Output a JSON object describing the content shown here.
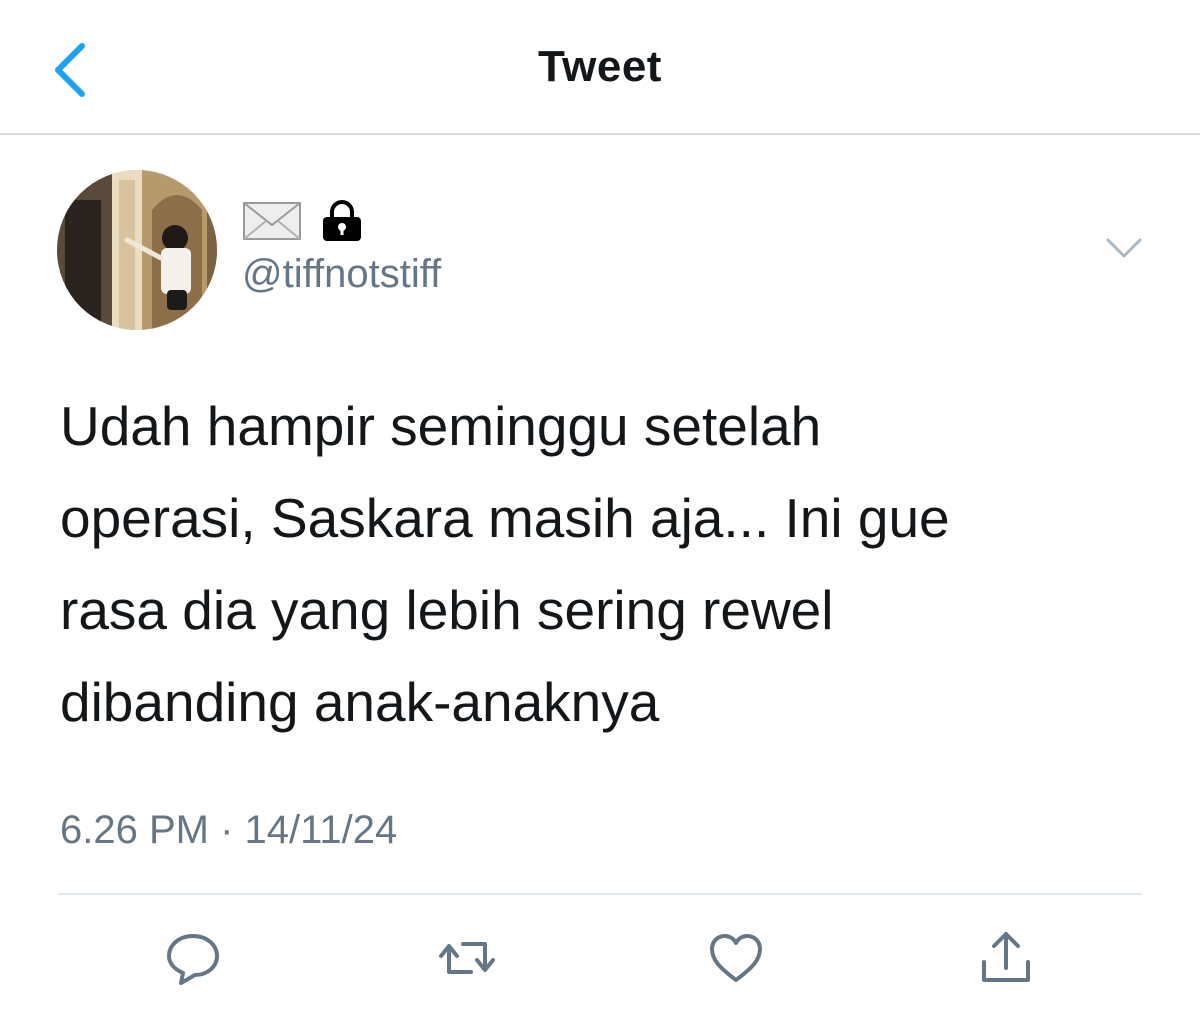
{
  "header": {
    "title": "Tweet",
    "back_icon": "chevron-left-icon"
  },
  "tweet": {
    "name_icons": [
      "envelope-icon",
      "lock-icon"
    ],
    "handle": "@tiffnotstiff",
    "text_lines": [
      "Udah hampir seminggu setelah",
      "operasi, Saskara masih aja... Ini gue",
      "rasa dia yang lebih sering rewel",
      "dibanding anak-anaknya"
    ],
    "timestamp": "6.26 PM · 14/11/24"
  },
  "actions": [
    "reply-icon",
    "retweet-icon",
    "like-icon",
    "share-icon"
  ],
  "colors": {
    "accent": "#1da1f2",
    "text": "#14171a",
    "secondary": "#657786",
    "divider": "#e1e8ed"
  }
}
